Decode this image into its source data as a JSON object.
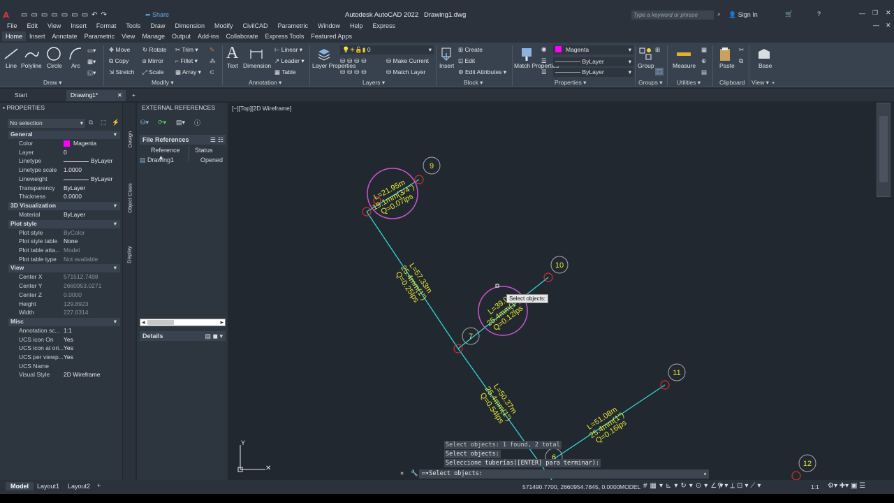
{
  "app": {
    "title": "Autodesk AutoCAD 2022",
    "document": "Drawing1.dwg",
    "share": "Share",
    "search_placeholder": "Type a keyword or phrase",
    "sign_in": "Sign In"
  },
  "menu": [
    "File",
    "Edit",
    "View",
    "Insert",
    "Format",
    "Tools",
    "Draw",
    "Dimension",
    "Modify",
    "CivilCAD",
    "Parametric",
    "Window",
    "Help",
    "Express"
  ],
  "ribbon_tabs": [
    "Home",
    "Insert",
    "Annotate",
    "Parametric",
    "View",
    "Manage",
    "Output",
    "Add-ins",
    "Collaborate",
    "Express Tools",
    "Featured Apps"
  ],
  "ribbon": {
    "draw": {
      "title": "Draw",
      "line": "Line",
      "polyline": "Polyline",
      "circle": "Circle",
      "arc": "Arc"
    },
    "modify": {
      "title": "Modify",
      "move": "Move",
      "rotate": "Rotate",
      "trim": "Trim",
      "copy": "Copy",
      "mirror": "Mirror",
      "fillet": "Fillet",
      "stretch": "Stretch",
      "scale": "Scale",
      "array": "Array"
    },
    "annotation": {
      "title": "Annotation",
      "text": "Text",
      "dimension": "Dimension",
      "linear": "Linear",
      "leader": "Leader",
      "table": "Table"
    },
    "layers": {
      "title": "Layers",
      "layer_properties": "Layer Properties",
      "current_layer": "0",
      "make_current": "Make Current",
      "match_layer": "Match Layer"
    },
    "block": {
      "title": "Block",
      "insert": "Insert",
      "create": "Create",
      "edit": "Edit",
      "edit_attributes": "Edit Attributes"
    },
    "properties": {
      "title": "Properties",
      "match_properties": "Match Properties",
      "color": "Magenta",
      "linetype": "ByLayer",
      "lineweight": "ByLayer"
    },
    "groups": {
      "title": "Groups",
      "group": "Group"
    },
    "utilities": {
      "title": "Utilities",
      "measure": "Measure"
    },
    "clipboard": {
      "title": "Clipboard",
      "paste": "Paste"
    },
    "view": {
      "title": "View",
      "base": "Base"
    }
  },
  "doc_tabs": [
    "Start",
    "Drawing1*"
  ],
  "properties_palette": {
    "header": "PROPERTIES",
    "selection": "No selection",
    "side_tabs": [
      "Design",
      "Object Class",
      "Display"
    ],
    "sections": [
      {
        "name": "General",
        "rows": [
          [
            "Color",
            "Magenta"
          ],
          [
            "Layer",
            "0"
          ],
          [
            "Linetype",
            "ByLayer"
          ],
          [
            "Linetype scale",
            "1.0000"
          ],
          [
            "Lineweight",
            "ByLayer"
          ],
          [
            "Transparency",
            "ByLayer"
          ],
          [
            "Thickness",
            "0.0000"
          ]
        ]
      },
      {
        "name": "3D Visualization",
        "rows": [
          [
            "Material",
            "ByLayer"
          ]
        ]
      },
      {
        "name": "Plot style",
        "rows": [
          [
            "Plot style",
            "ByColor"
          ],
          [
            "Plot style table",
            "None"
          ],
          [
            "Plot table atta...",
            "Model"
          ],
          [
            "Plot table type",
            "Not available"
          ]
        ]
      },
      {
        "name": "View",
        "rows": [
          [
            "Center X",
            "571512.7498"
          ],
          [
            "Center Y",
            "2660953.0271"
          ],
          [
            "Center Z",
            "0.0000"
          ],
          [
            "Height",
            "129.8923"
          ],
          [
            "Width",
            "227.6314"
          ]
        ]
      },
      {
        "name": "Misc",
        "rows": [
          [
            "Annotation sc...",
            "1:1"
          ],
          [
            "UCS icon On",
            "Yes"
          ],
          [
            "UCS icon at ori...",
            "Yes"
          ],
          [
            "UCS per viewp...",
            "Yes"
          ],
          [
            "UCS Name",
            ""
          ],
          [
            "Visual Style",
            "2D Wireframe"
          ]
        ]
      }
    ]
  },
  "external_refs": {
    "header": "EXTERNAL REFERENCES",
    "file_refs": "File References",
    "col_ref": "Reference ...",
    "col_status": "Status",
    "rows": [
      [
        "Drawing1",
        "Opened"
      ]
    ],
    "details": "Details"
  },
  "viewport": {
    "label": "[−][Top][2D Wireframe]",
    "tooltip": "Select objects:",
    "nodes": [
      "9",
      "10",
      "7",
      "11",
      "6",
      "12"
    ],
    "pipes": [
      {
        "L": "L=21.95m",
        "D": "19.1mm(3/4\")",
        "Q": "Q=0.07lps"
      },
      {
        "L": "L=57.33m",
        "D": "25.4mm(1\")",
        "Q": "Q=0.25lps"
      },
      {
        "L": "L=39.0",
        "D": "25.4mm(1\")",
        "Q": "Q=0.12lps"
      },
      {
        "L": "L=50.37m",
        "D": "25.4mm(1\")",
        "Q": "Q=0.54lps"
      },
      {
        "L": "L=51.08m",
        "D": "25.4mm(1\")",
        "Q": "Q=0.16lps"
      }
    ]
  },
  "command": {
    "history": [
      "Select objects: 1 found, 2 total",
      "Select objects:",
      "Seleccione tuberías([ENTER] para terminar):"
    ],
    "prompt": "Select objects:"
  },
  "status": {
    "coords": "571490.7700, 2660954.7845, 0.0000",
    "model": "MODEL",
    "scale": "1:1"
  },
  "layout_tabs": [
    "Model",
    "Layout1",
    "Layout2"
  ],
  "colors": {
    "pipe": "#33d6d6",
    "label": "#e6e634",
    "highlight": "#cc55cc",
    "node_marker": "#d03030",
    "magenta": "#ff00ff"
  }
}
